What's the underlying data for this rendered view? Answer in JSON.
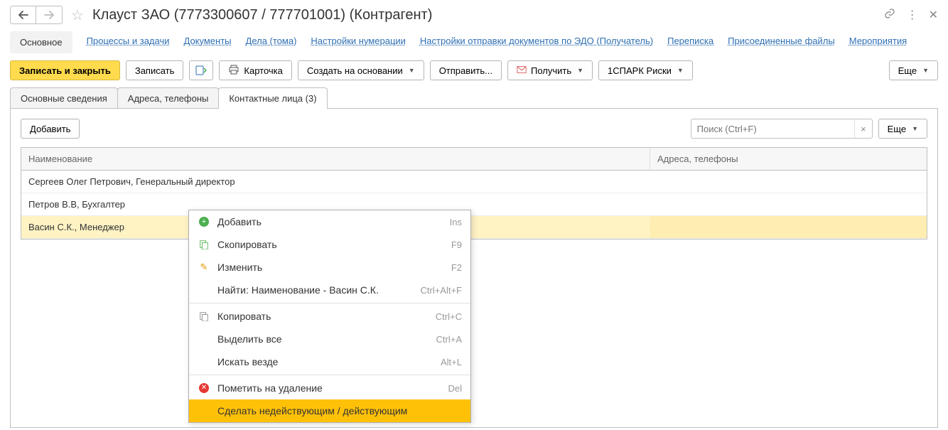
{
  "header": {
    "title": "Клауст ЗАО (7773300607 / 777701001) (Контрагент)"
  },
  "nav": {
    "items": [
      "Основное",
      "Процессы и задачи",
      "Документы",
      "Дела (тома)",
      "Настройки нумерации",
      "Настройки отправки документов по ЭДО (Получатель)",
      "Переписка",
      "Присоединенные файлы",
      "Мероприятия"
    ],
    "activeIndex": 0
  },
  "toolbar": {
    "save_close": "Записать и закрыть",
    "save": "Записать",
    "card": "Карточка",
    "create_based": "Создать на основании",
    "send": "Отправить...",
    "receive": "Получить",
    "spark": "1СПАРК Риски",
    "more": "Еще"
  },
  "sub_tabs": {
    "items": [
      "Основные сведения",
      "Адреса, телефоны",
      "Контактные лица (3)"
    ],
    "activeIndex": 2
  },
  "list_toolbar": {
    "add": "Добавить",
    "search_placeholder": "Поиск (Ctrl+F)",
    "more": "Еще"
  },
  "table": {
    "columns": [
      "Наименование",
      "Адреса, телефоны"
    ],
    "rows": [
      {
        "name": "Сергеев Олег Петрович, Генеральный директор",
        "addr": ""
      },
      {
        "name": "Петров В.В, Бухгалтер",
        "addr": ""
      },
      {
        "name": "Васин С.К., Менеджер",
        "addr": ""
      }
    ],
    "selectedIndex": 2
  },
  "context_menu": {
    "items": [
      {
        "icon": "add",
        "label": "Добавить",
        "shortcut": "Ins"
      },
      {
        "icon": "copyg",
        "label": "Скопировать",
        "shortcut": "F9"
      },
      {
        "icon": "pencil",
        "label": "Изменить",
        "shortcut": "F2"
      },
      {
        "icon": "",
        "label": "Найти: Наименование - Васин С.К.",
        "shortcut": "Ctrl+Alt+F"
      },
      {
        "sep": true
      },
      {
        "icon": "copy",
        "label": "Копировать",
        "shortcut": "Ctrl+C"
      },
      {
        "icon": "",
        "label": "Выделить все",
        "shortcut": "Ctrl+A"
      },
      {
        "icon": "",
        "label": "Искать везде",
        "shortcut": "Alt+L"
      },
      {
        "sep": true
      },
      {
        "icon": "del",
        "label": "Пометить на удаление",
        "shortcut": "Del"
      },
      {
        "icon": "",
        "label": "Сделать недействующим / действующим",
        "shortcut": "",
        "highlight": true
      }
    ]
  }
}
